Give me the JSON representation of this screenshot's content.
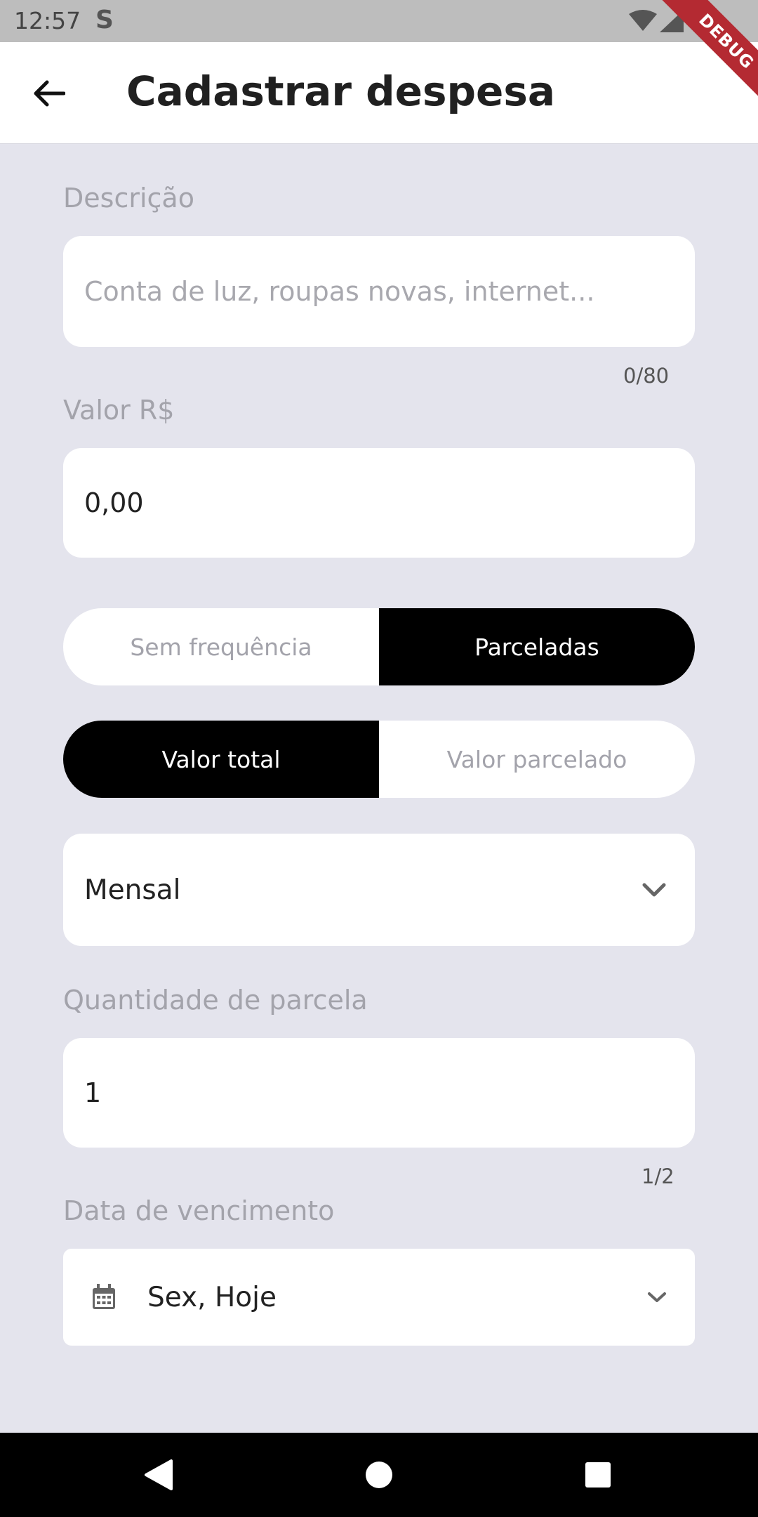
{
  "status_bar": {
    "time": "12:57",
    "app_icon": "S"
  },
  "debug_banner": {
    "text": "DEBUG",
    "color": "#b42a32"
  },
  "app_bar": {
    "title": "Cadastrar despesa",
    "back_icon": "arrow-left-icon"
  },
  "description": {
    "label": "Descrição",
    "placeholder": "Conta de luz, roupas novas, internet...",
    "value": "",
    "counter": "0/80"
  },
  "amount": {
    "label": "Valor R$",
    "value": "0,00"
  },
  "frequency_toggle": {
    "options": [
      "Sem frequência",
      "Parceladas"
    ],
    "selected": "Parceladas"
  },
  "value_type_toggle": {
    "options": [
      "Valor total",
      "Valor parcelado"
    ],
    "selected": "Valor total"
  },
  "period_dropdown": {
    "selected": "Mensal"
  },
  "installments": {
    "label": "Quantidade de parcela",
    "value": "1",
    "counter": "1/2"
  },
  "due_date": {
    "label": "Data de vencimento",
    "value": "Sex, Hoje",
    "icon": "calendar-icon"
  },
  "colors": {
    "background": "#e4e4ed",
    "surface": "#ffffff",
    "active": "#000000",
    "muted_text": "#a3a3ab"
  }
}
